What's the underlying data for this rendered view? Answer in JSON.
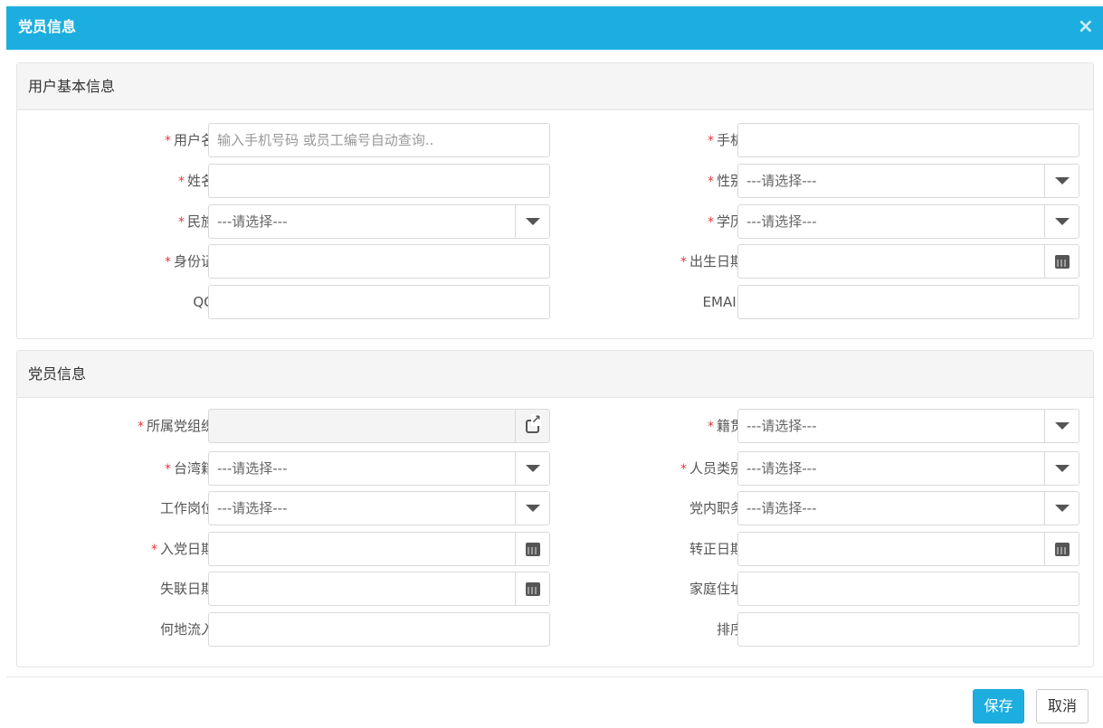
{
  "dialog": {
    "title": "党员信息",
    "close_glyph": "×"
  },
  "required_mark": "*",
  "section1": {
    "heading": "用户基本信息",
    "username": {
      "label": "用户名",
      "placeholder": "输入手机号码 或员工编号自动查询..",
      "value": ""
    },
    "phone": {
      "label": "手机",
      "value": ""
    },
    "name": {
      "label": "姓名",
      "value": ""
    },
    "gender": {
      "label": "性别",
      "selected": "---请选择---"
    },
    "ethnicity": {
      "label": "民族",
      "selected": "---请选择---"
    },
    "education": {
      "label": "学历",
      "selected": "---请选择---"
    },
    "id_card": {
      "label": "身份证",
      "value": ""
    },
    "birth_date": {
      "label": "出生日期",
      "value": ""
    },
    "qq": {
      "label": "QQ",
      "value": ""
    },
    "email": {
      "label": "EMAIL",
      "value": ""
    }
  },
  "section2": {
    "heading": "党员信息",
    "party_org": {
      "label": "所属党组织",
      "value": ""
    },
    "native_place": {
      "label": "籍贯",
      "selected": "---请选择---"
    },
    "taiwan": {
      "label": "台湾籍",
      "selected": "---请选择---"
    },
    "personnel_type": {
      "label": "人员类别",
      "selected": "---请选择---"
    },
    "job_post": {
      "label": "工作岗位",
      "selected": "---请选择---"
    },
    "party_duty": {
      "label": "党内职务",
      "selected": "---请选择---"
    },
    "join_date": {
      "label": "入党日期",
      "value": ""
    },
    "regular_date": {
      "label": "转正日期",
      "value": ""
    },
    "lost_date": {
      "label": "失联日期",
      "value": ""
    },
    "home_address": {
      "label": "家庭住址",
      "value": ""
    },
    "flow_from": {
      "label": "何地流入",
      "value": ""
    },
    "sort": {
      "label": "排序",
      "value": ""
    }
  },
  "footer": {
    "save_label": "保存",
    "cancel_label": "取消"
  },
  "colors": {
    "primary": "#1caedf",
    "required": "#e4393c"
  },
  "icons": {
    "close": "close-icon",
    "dropdown": "caret-down-icon",
    "date": "calendar-icon",
    "picker": "external-link-icon"
  }
}
